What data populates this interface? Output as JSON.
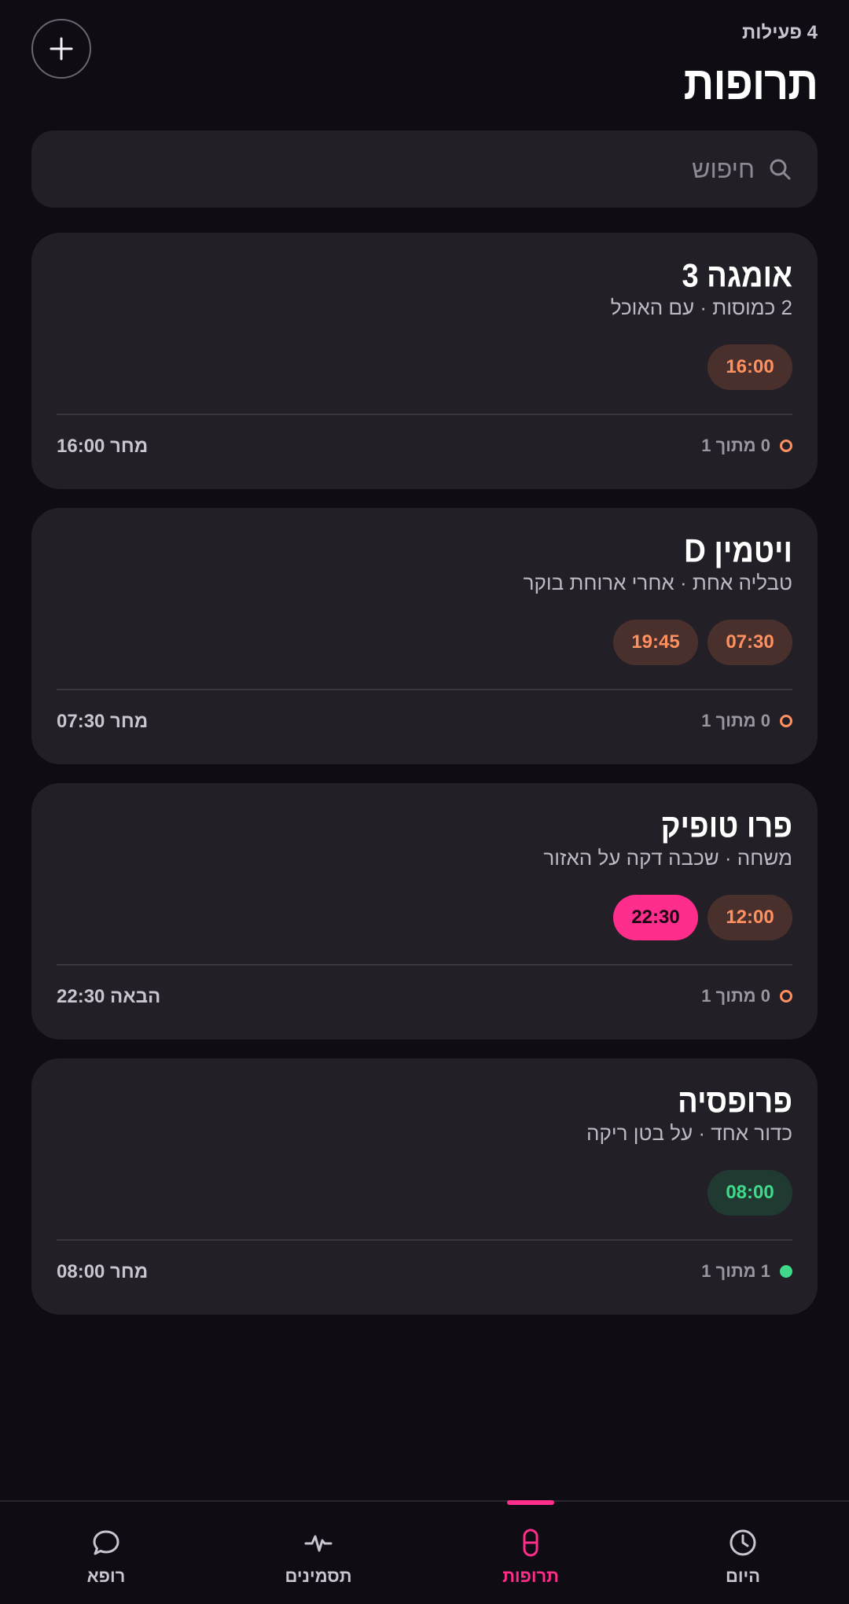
{
  "header": {
    "count": "4 פעילות",
    "title": "תרופות"
  },
  "search": {
    "placeholder": "חיפוש",
    "icon": "search-icon"
  },
  "cards": [
    {
      "name": "אומגה 3",
      "desc": "2 כמוסות · עם האוכל",
      "times": [
        {
          "label": "16:00",
          "state": "pending"
        }
      ],
      "progress": "0 מתוך 1",
      "progress_state": "pending",
      "next": "מחר 16:00"
    },
    {
      "name": "ויטמין D",
      "desc": "טבליה אחת · אחרי ארוחת בוקר",
      "times": [
        {
          "label": "07:30",
          "state": "pending"
        },
        {
          "label": "19:45",
          "state": "pending"
        }
      ],
      "progress": "0 מתוך 1",
      "progress_state": "pending",
      "next": "מחר 07:30"
    },
    {
      "name": "פרו טופיק",
      "desc": "משחה · שכבה דקה על האזור",
      "times": [
        {
          "label": "12:00",
          "state": "pending"
        },
        {
          "label": "22:30",
          "state": "next"
        }
      ],
      "progress": "0 מתוך 1",
      "progress_state": "pending",
      "next": "הבאה 22:30"
    },
    {
      "name": "פרופסיה",
      "desc": "כדור אחד · על בטן ריקה",
      "times": [
        {
          "label": "08:00",
          "state": "done"
        }
      ],
      "progress": "1 מתוך 1",
      "progress_state": "done",
      "next": "מחר 08:00"
    }
  ],
  "nav": {
    "items": [
      {
        "label": "היום",
        "icon": "clock-icon",
        "active": false
      },
      {
        "label": "תרופות",
        "icon": "pill-icon",
        "active": true
      },
      {
        "label": "תסמינים",
        "icon": "pulse-icon",
        "active": false
      },
      {
        "label": "רופא",
        "icon": "chat-bubble-icon",
        "active": false
      }
    ]
  },
  "colors": {
    "background": "#0f0c13",
    "card": "#221f27",
    "accent": "#ff2d8c",
    "pending": "#ff9060",
    "done": "#40d98a"
  }
}
